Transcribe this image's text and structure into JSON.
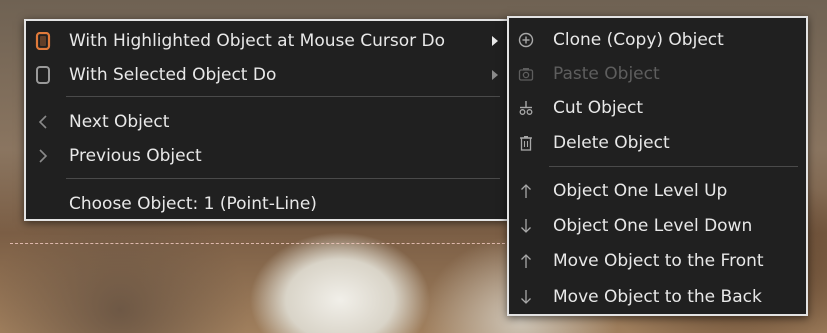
{
  "main_menu": {
    "items": [
      {
        "label": "With Highlighted Object at Mouse Cursor Do",
        "icon": "object-highlight-icon"
      },
      {
        "label": "With Selected Object Do",
        "icon": "object-selected-icon"
      },
      {
        "label": "Next Object",
        "icon": "chevron-left-icon"
      },
      {
        "label": "Previous Object",
        "icon": "chevron-right-icon"
      },
      {
        "label": "Choose Object: 1 (Point-Line)",
        "icon": ""
      }
    ],
    "accent_color": "#e07a3a"
  },
  "submenu": {
    "items": [
      {
        "label": "Clone (Copy) Object",
        "icon": "plus-circle-icon",
        "disabled": false
      },
      {
        "label": "Paste Object",
        "icon": "camera-icon",
        "disabled": true
      },
      {
        "label": "Cut Object",
        "icon": "cut-icon",
        "disabled": false
      },
      {
        "label": "Delete Object",
        "icon": "trash-icon",
        "disabled": false
      },
      {
        "label": "Object One Level Up",
        "icon": "arrow-up-icon",
        "disabled": false
      },
      {
        "label": "Object One Level Down",
        "icon": "arrow-down-icon",
        "disabled": false
      },
      {
        "label": "Move Object to the Front",
        "icon": "arrow-up-icon",
        "disabled": false
      },
      {
        "label": "Move Object to the Back",
        "icon": "arrow-down-icon",
        "disabled": false
      }
    ]
  }
}
